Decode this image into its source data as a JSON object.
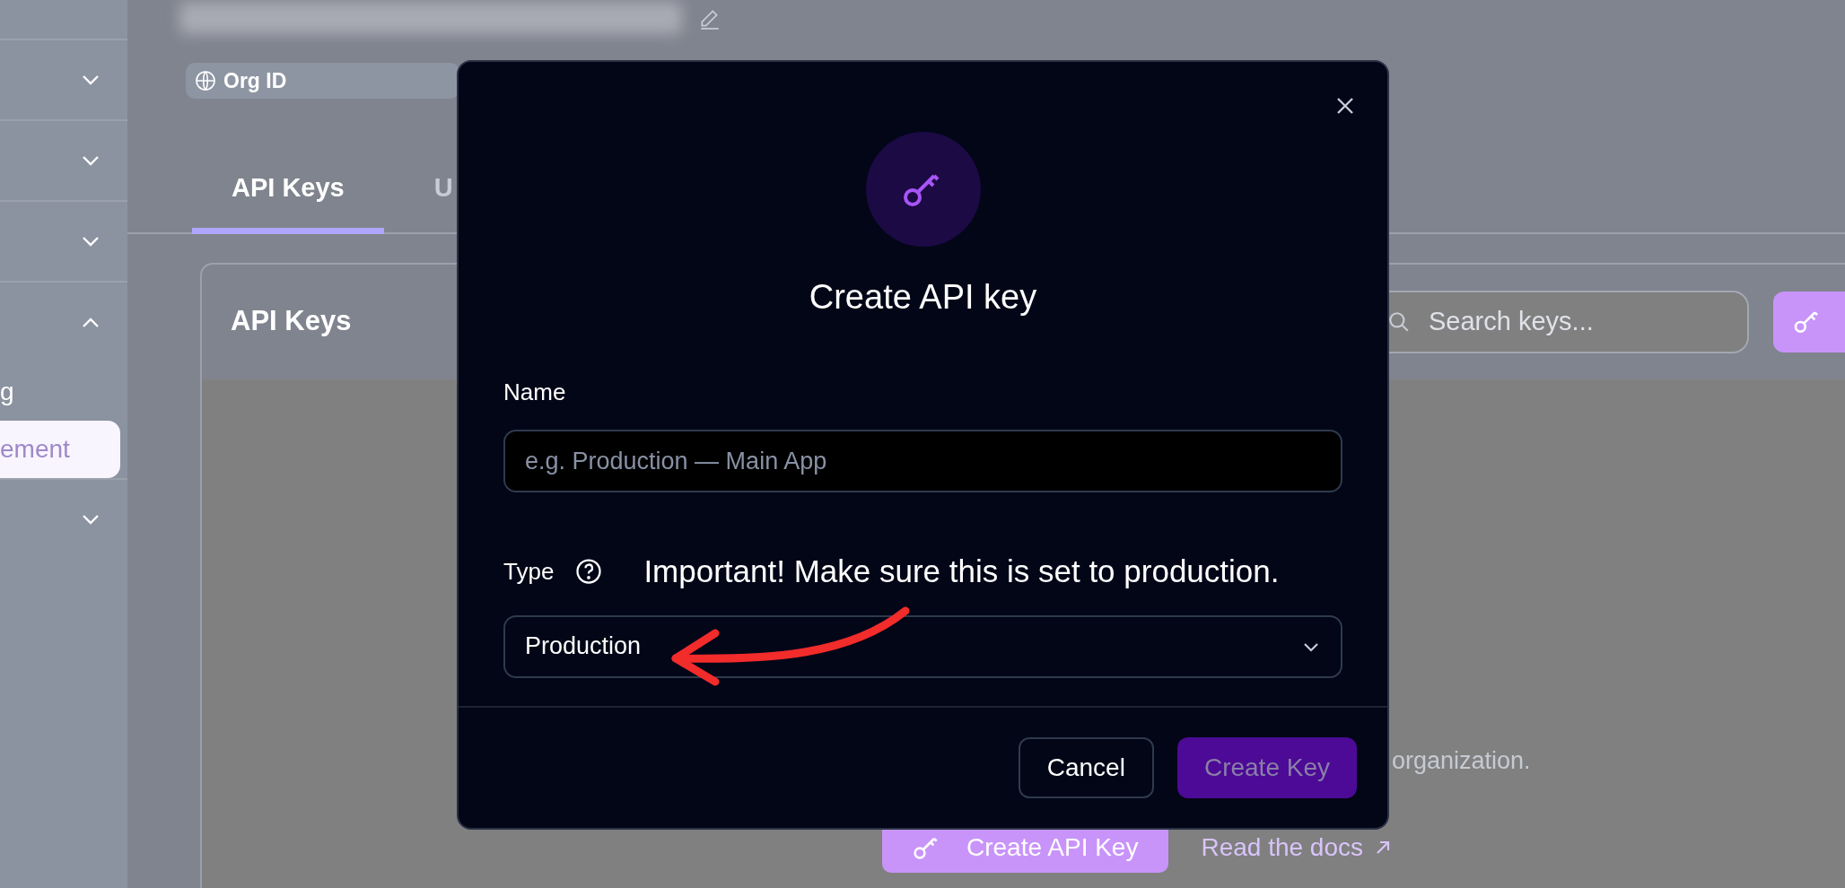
{
  "sidebar": {
    "sections": [
      {
        "expanded": false
      },
      {
        "expanded": false
      },
      {
        "expanded": false
      },
      {
        "expanded": true,
        "children": [
          {
            "label": "g",
            "selected": false
          },
          {
            "label": "ement",
            "selected": true
          }
        ]
      },
      {
        "expanded": false
      }
    ]
  },
  "header": {
    "org_id_label": "Org ID"
  },
  "tabs": [
    {
      "label": "API Keys",
      "selected": true
    },
    {
      "label": "U",
      "selected": false
    }
  ],
  "card": {
    "title": "API Keys",
    "search": {
      "placeholder": "Search keys..."
    },
    "empty_text": "organization.",
    "create_button": "Create API Key",
    "docs_link": "Read the docs"
  },
  "modal": {
    "title": "Create API key",
    "name_label": "Name",
    "name_placeholder": "e.g. Production — Main App",
    "type_label": "Type",
    "type_value": "Production",
    "annotation": "Important! Make sure this is set to production.",
    "buttons": [
      {
        "label": "Cancel",
        "kind": "secondary",
        "disabled": false
      },
      {
        "label": "Create Key",
        "kind": "primary",
        "disabled": true
      }
    ]
  }
}
